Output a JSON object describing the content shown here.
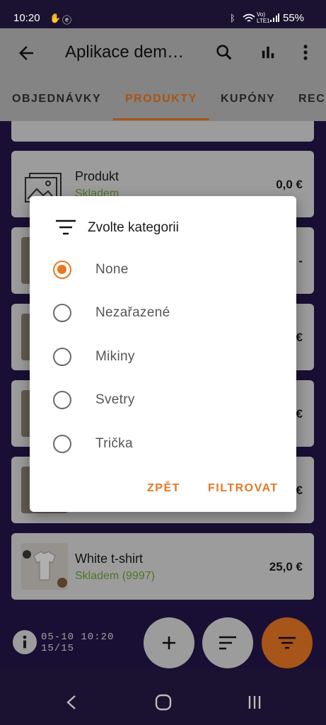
{
  "statusbar": {
    "time": "10:20",
    "battery": "55%",
    "icons": [
      "notification-icon",
      "app-icon",
      "bluetooth-icon",
      "wifi-icon",
      "volte-icon",
      "signal-icon"
    ]
  },
  "appbar": {
    "title": "Aplikace dem…",
    "icons": [
      "back-arrow-icon",
      "search-icon",
      "bar-chart-icon",
      "more-vert-icon"
    ]
  },
  "tabs": [
    {
      "label": "OBJEDNÁVKY"
    },
    {
      "label": "PRODUKTY",
      "active": true
    },
    {
      "label": "KUPÓNY"
    },
    {
      "label": "REC"
    }
  ],
  "products": [
    {
      "name": "Produkt",
      "stock": "Skladem",
      "price": "0,0 €"
    },
    {
      "name": "",
      "stock": "",
      "price": "-"
    },
    {
      "name": "",
      "stock": "",
      "price": "€"
    },
    {
      "name": "",
      "stock": "",
      "price": "€"
    },
    {
      "name": "",
      "stock": "",
      "price": "€"
    },
    {
      "name": "White t-shirt",
      "stock": "Skladem (9997)",
      "price": "25,0 €"
    }
  ],
  "footer": {
    "line1": "05-10 10:20",
    "line2": "15/15"
  },
  "dialog": {
    "title": "Zvolte kategorii",
    "options": [
      {
        "label": "None",
        "selected": true
      },
      {
        "label": "Nezařazené",
        "selected": false
      },
      {
        "label": "Mikiny",
        "selected": false
      },
      {
        "label": "Svetry",
        "selected": false
      },
      {
        "label": "Trička",
        "selected": false
      }
    ],
    "back_label": "ZPĚT",
    "filter_label": "FILTROVAT"
  },
  "colors": {
    "accent": "#e87722",
    "background": "#23164a",
    "stock_green": "#6ca33a"
  }
}
